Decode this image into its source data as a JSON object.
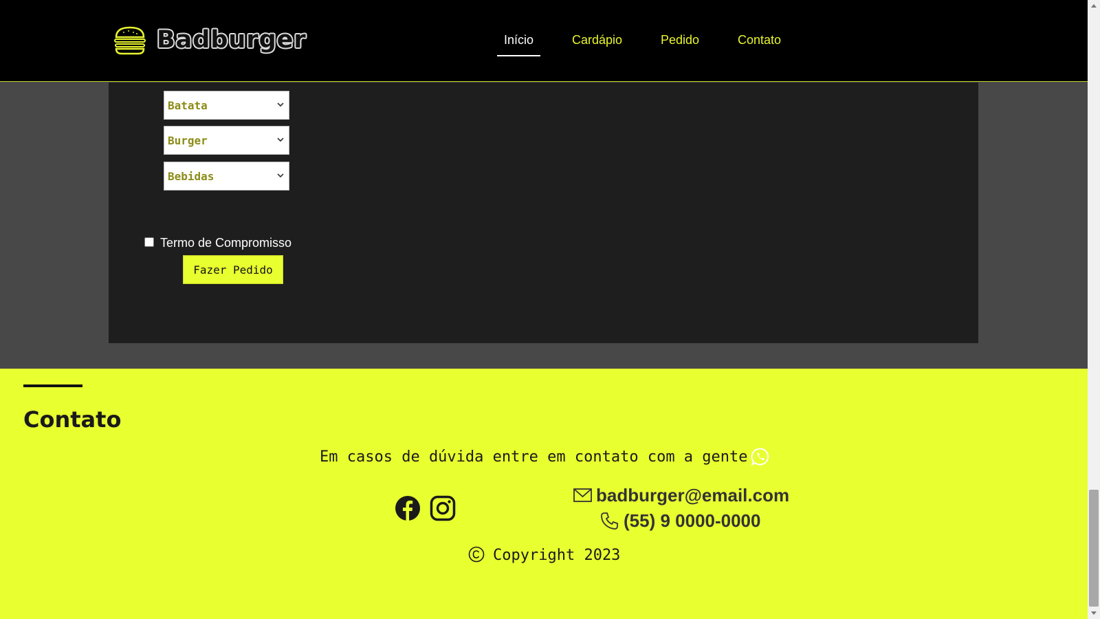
{
  "brand": {
    "name": "Badburger",
    "logo_icon": "burger-icon"
  },
  "nav": {
    "items": [
      {
        "label": "Início",
        "active": true
      },
      {
        "label": "Cardápio",
        "active": false
      },
      {
        "label": "Pedido",
        "active": false
      },
      {
        "label": "Contato",
        "active": false
      }
    ]
  },
  "order_form": {
    "selects": [
      {
        "value": "Batata"
      },
      {
        "value": "Burger"
      },
      {
        "value": "Bebidas"
      }
    ],
    "terms_label": "Termo de Compromisso",
    "terms_checked": false,
    "submit_label": "Fazer Pedido"
  },
  "footer": {
    "title": "Contato",
    "help_text": "Em casos de dúvida entre em contato com a gente",
    "email": "badburger@email.com",
    "phone": "(55) 9 0000-0000",
    "copyright": "Copyright 2023",
    "icons": [
      "whatsapp-icon",
      "facebook-icon",
      "instagram-icon",
      "mail-icon",
      "phone-icon",
      "copyright-icon"
    ]
  },
  "colors": {
    "accent": "#e8ff30",
    "header_bg": "#000000",
    "panel_bg": "#1e1e1e",
    "page_bg": "#484848",
    "select_text": "#8c8c18"
  }
}
